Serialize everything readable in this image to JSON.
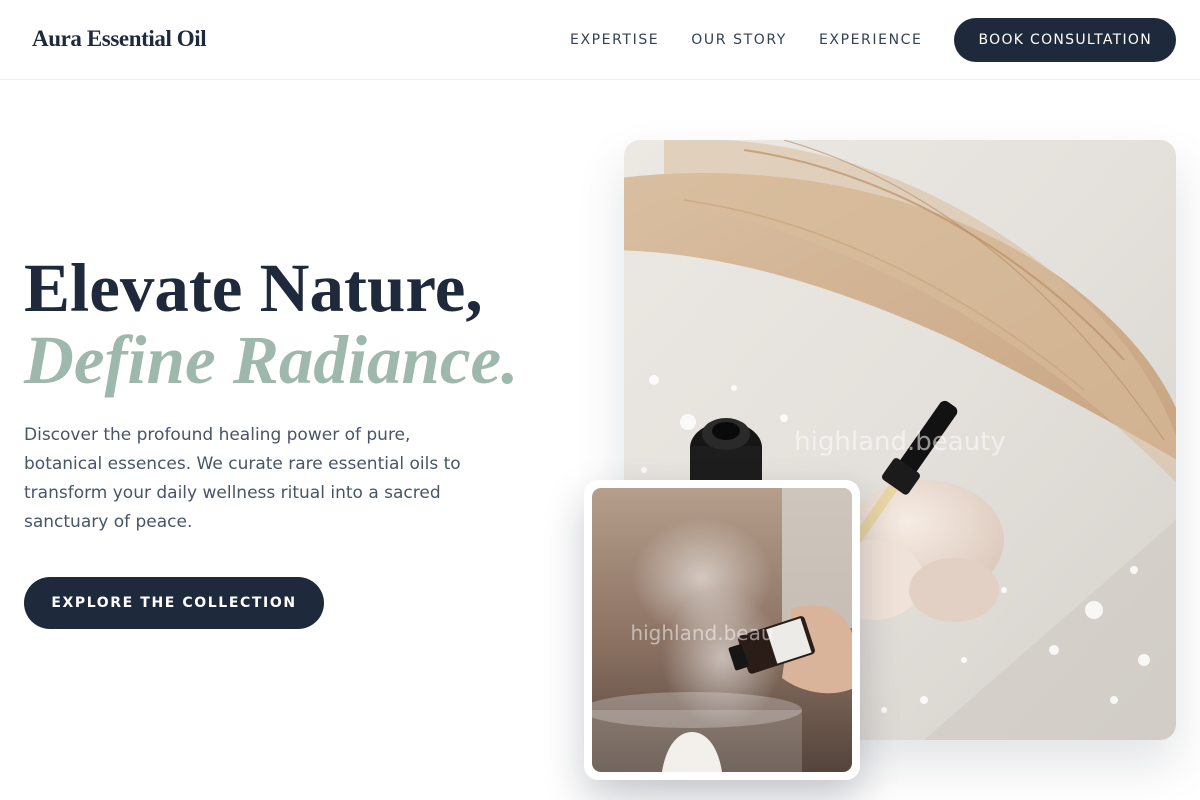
{
  "brand": {
    "name": "Aura Essential Oil"
  },
  "nav": {
    "links": [
      "EXPERTISE",
      "OUR STORY",
      "EXPERIENCE"
    ],
    "cta": "BOOK CONSULTATION"
  },
  "hero": {
    "title_line1": "Elevate Nature,",
    "title_line2": "Define Radiance.",
    "description": "Discover the profound healing power of pure, botanical essences. We curate rare essential oils to transform your daily wellness ritual into a sacred sanctuary of peace.",
    "cta": "EXPLORE THE COLLECTION"
  },
  "media": {
    "watermark": "highland.beauty",
    "inset_watermark": "highland.beau"
  },
  "colors": {
    "navy": "#1e293b",
    "sage": "#9fb8ad",
    "body_text": "#475569"
  }
}
